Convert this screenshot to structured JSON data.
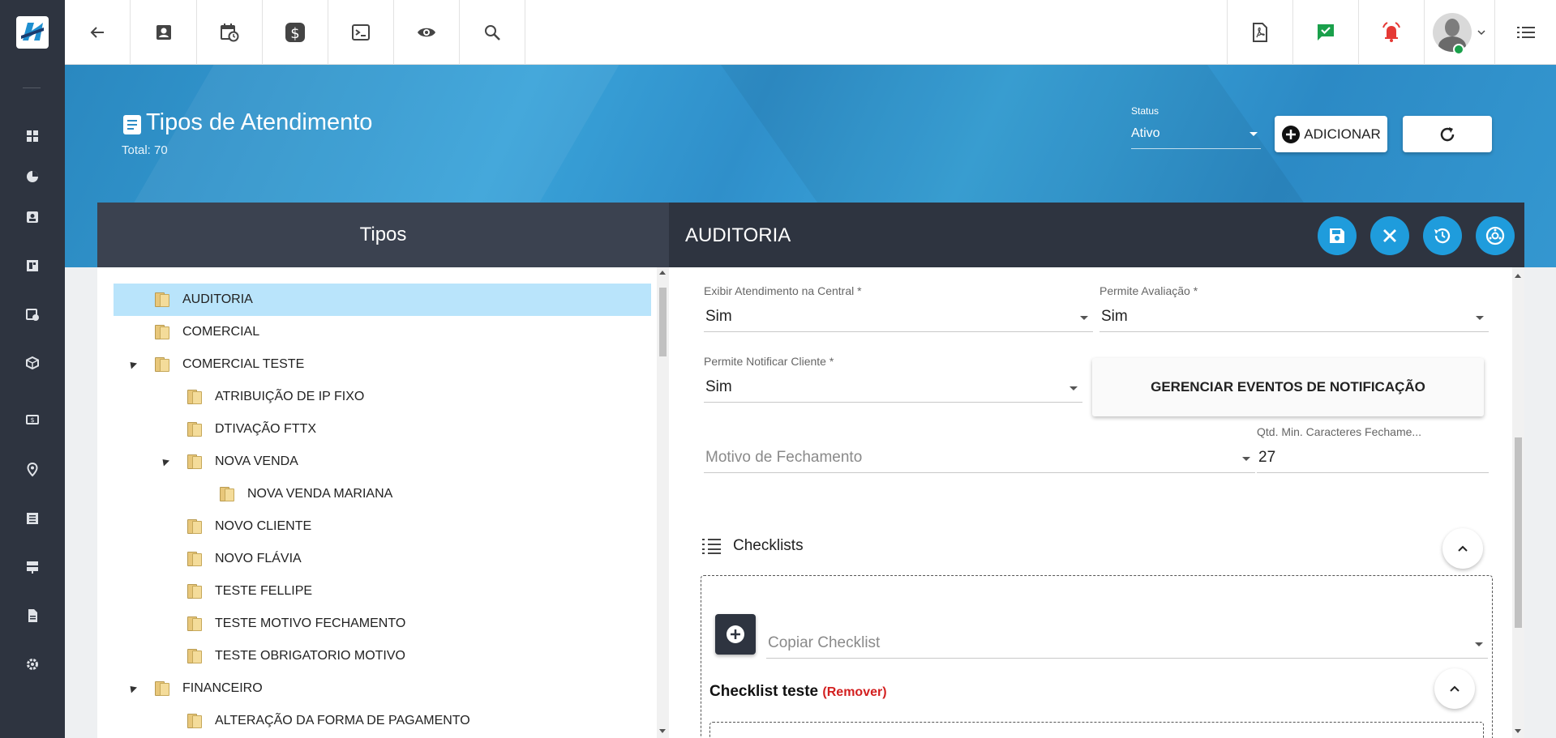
{
  "topbar": {
    "left_icons": [
      "back-arrow-icon",
      "contact-card-icon",
      "calendar-clock-icon",
      "dollar-icon",
      "terminal-icon",
      "eye-icon",
      "search-icon"
    ],
    "right_icons": [
      "pdf-icon",
      "chat-check-icon",
      "alarm-bell-icon",
      "user-avatar-icon",
      "list-menu-icon"
    ]
  },
  "sidebar": {
    "icons": [
      "dashboard-icon",
      "pie-chart-icon",
      "contact-card-icon",
      "layout-icon",
      "calendar-clock-icon",
      "package-icon",
      "money-icon",
      "map-pin-icon",
      "list-document-icon",
      "server-icon",
      "file-icon",
      "gear-icon"
    ]
  },
  "header": {
    "title": "Tipos de Atendimento",
    "total": "Total: 70",
    "status_label": "Status",
    "status_value": "Ativo",
    "add_label": "ADICIONAR"
  },
  "tree": {
    "title": "Tipos",
    "items": [
      {
        "label": "AUDITORIA",
        "level": 0,
        "selected": true,
        "expanded": false
      },
      {
        "label": "COMERCIAL",
        "level": 0,
        "selected": false,
        "expanded": false
      },
      {
        "label": "COMERCIAL TESTE",
        "level": 0,
        "selected": false,
        "expanded": true
      },
      {
        "label": "ATRIBUIÇÃO DE IP FIXO",
        "level": 1,
        "selected": false,
        "expanded": false
      },
      {
        "label": "DTIVAÇÃO FTTX",
        "level": 1,
        "selected": false,
        "expanded": false
      },
      {
        "label": "NOVA VENDA",
        "level": 1,
        "selected": false,
        "expanded": true
      },
      {
        "label": "NOVA VENDA MARIANA",
        "level": 2,
        "selected": false,
        "expanded": false
      },
      {
        "label": "NOVO CLIENTE",
        "level": 1,
        "selected": false,
        "expanded": false
      },
      {
        "label": "NOVO FLÁVIA",
        "level": 1,
        "selected": false,
        "expanded": false
      },
      {
        "label": "TESTE FELLIPE",
        "level": 1,
        "selected": false,
        "expanded": false
      },
      {
        "label": "TESTE MOTIVO FECHAMENTO",
        "level": 1,
        "selected": false,
        "expanded": false
      },
      {
        "label": "TESTE OBRIGATORIO MOTIVO",
        "level": 1,
        "selected": false,
        "expanded": false
      },
      {
        "label": "FINANCEIRO",
        "level": 0,
        "selected": false,
        "expanded": true
      },
      {
        "label": "ALTERAÇÃO DA FORMA DE PAGAMENTO",
        "level": 1,
        "selected": false,
        "expanded": false
      }
    ]
  },
  "detail": {
    "title": "AUDITORIA",
    "fields": {
      "exibir_label": "Exibir Atendimento na Central *",
      "exibir_value": "Sim",
      "avaliacao_label": "Permite Avaliação *",
      "avaliacao_value": "Sim",
      "notificar_label": "Permite Notificar Cliente *",
      "notificar_value": "Sim",
      "notif_button": "GERENCIAR EVENTOS DE NOTIFICAÇÃO",
      "motivo_placeholder": "Motivo de Fechamento",
      "qtd_label": "Qtd. Min. Caracteres Fechame...",
      "qtd_value": "27"
    },
    "checklists": {
      "title": "Checklists",
      "copy_placeholder": "Copiar Checklist",
      "item_name": "Checklist teste",
      "remove_label": "(Remover)"
    }
  },
  "colors": {
    "sidebar_bg": "#2e3440",
    "accent_blue": "#1f9cdc",
    "selected_row": "#b9e4fb",
    "remove_red": "#d32020"
  }
}
